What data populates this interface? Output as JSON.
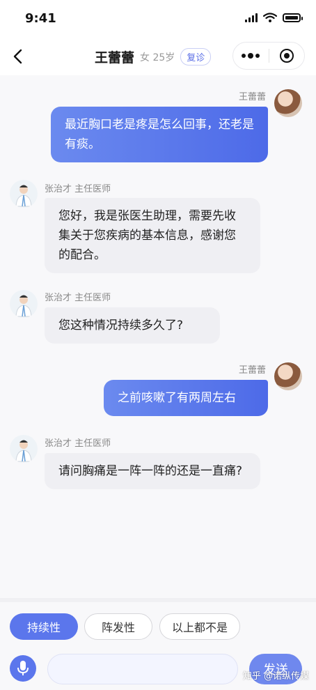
{
  "status_bar": {
    "time": "9:41"
  },
  "header": {
    "title": "王蕾蕾",
    "meta": "女 25岁",
    "tag": "复诊"
  },
  "messages": [
    {
      "sender": "王蕾蕾",
      "text": "最近胸口老是疼是怎么回事，还老是有痰。"
    },
    {
      "sender": "张治才 主任医师",
      "text": "您好，我是张医生助理，需要先收集关于您疾病的基本信息，感谢您的配合。"
    },
    {
      "sender": "张治才 主任医师",
      "text": "您这种情况持续多久了?"
    },
    {
      "sender": "王蕾蕾",
      "text": "之前咳嗽了有两周左右"
    },
    {
      "sender": "张治才 主任医师",
      "text": "请问胸痛是一阵一阵的还是一直痛?"
    }
  ],
  "quick_replies": [
    "持续性",
    "阵发性",
    "以上都不是"
  ],
  "input": {
    "placeholder": "",
    "send_label": "发送"
  },
  "watermark": "知乎 @诺纵传媒",
  "colors": {
    "accent": "#5b76ec",
    "incoming_bubble": "#efeff3"
  },
  "icons": {
    "back": "chevron-left-icon",
    "more": "more-dots-icon",
    "close": "target-close-icon",
    "mic": "microphone-icon"
  }
}
